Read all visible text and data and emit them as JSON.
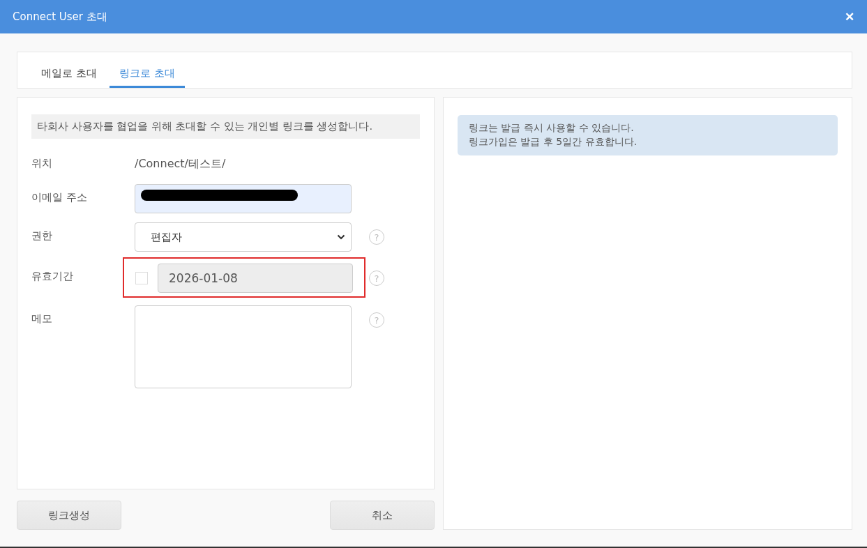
{
  "window": {
    "title": "Connect User 초대",
    "close": "✕"
  },
  "tabs": [
    {
      "label": "메일로 초대",
      "selected": false
    },
    {
      "label": "링크로 초대",
      "selected": true
    }
  ],
  "notice": "타회사 사용자를 협업을 위해 초대할 수 있는 개인별 링크를 생성합니다.",
  "form": [
    {
      "kind": "text",
      "label": "위치",
      "value": "/Connect/테스트/"
    },
    {
      "kind": "email",
      "label": "이메일 주소",
      "redacted": true
    },
    {
      "kind": "select",
      "label": "권한",
      "value": "편집자",
      "help": "?"
    },
    {
      "kind": "date",
      "label": "유효기간",
      "checked": false,
      "value": "2026-01-08",
      "disabled": true,
      "highlighted": true,
      "help": "?"
    },
    {
      "kind": "textarea",
      "label": "메모",
      "help": "?"
    }
  ],
  "info": [
    "링크는 발급 즉시 사용할 수 있습니다.",
    "링크가입은 발급 후 5일간 유효합니다."
  ],
  "buttons": {
    "create": "링크생성",
    "cancel": "취소"
  }
}
